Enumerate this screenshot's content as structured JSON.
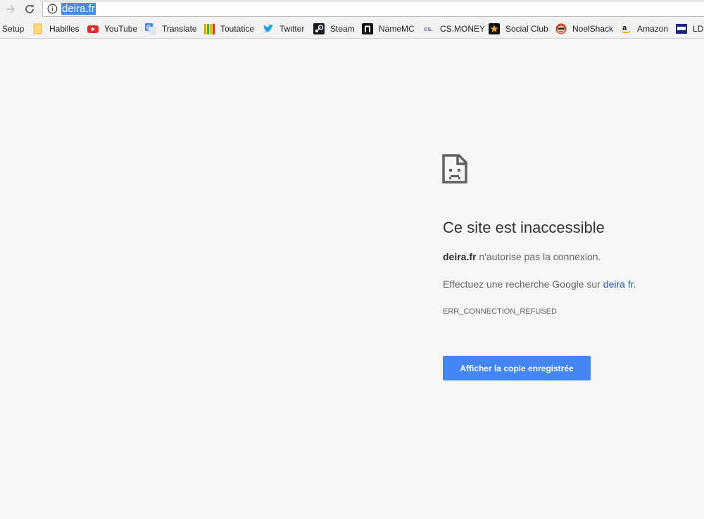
{
  "toolbar": {
    "url": "deira.fr"
  },
  "bookmarks": [
    {
      "label": "Setup",
      "icon": "setup-icon"
    },
    {
      "label": "Habilles",
      "icon": "folder-icon"
    },
    {
      "label": "YouTube",
      "icon": "youtube-icon"
    },
    {
      "label": "Translate",
      "icon": "google-translate-icon"
    },
    {
      "label": "Toutatice",
      "icon": "toutatice-icon"
    },
    {
      "label": "Twitter",
      "icon": "twitter-bird-icon"
    },
    {
      "label": "Steam",
      "icon": "steam-icon"
    },
    {
      "label": "NameMC",
      "icon": "namemc-icon"
    },
    {
      "label": "CS.MONEY",
      "icon": "csmoney-icon"
    },
    {
      "label": "Social Club",
      "icon": "social-club-icon"
    },
    {
      "label": "NoelShack",
      "icon": "noelshack-icon"
    },
    {
      "label": "Amazon",
      "icon": "amazon-icon"
    },
    {
      "label": "LD",
      "icon": "ld-icon"
    }
  ],
  "error": {
    "icon": "sad-page-icon",
    "title": "Ce site est inaccessible",
    "host": "deira.fr",
    "host_message": "n'autorise pas la connexion.",
    "search_prefix": "Effectuez une recherche Google sur",
    "search_link": "deira fr",
    "search_suffix": ".",
    "code": "ERR_CONNECTION_REFUSED",
    "button_label": "Afficher la copie enregistrée"
  },
  "colors": {
    "page_background": "#f6f6f6",
    "button": "#4285f4",
    "link": "#1a56c8",
    "url_highlight": "#3d8ef0"
  }
}
